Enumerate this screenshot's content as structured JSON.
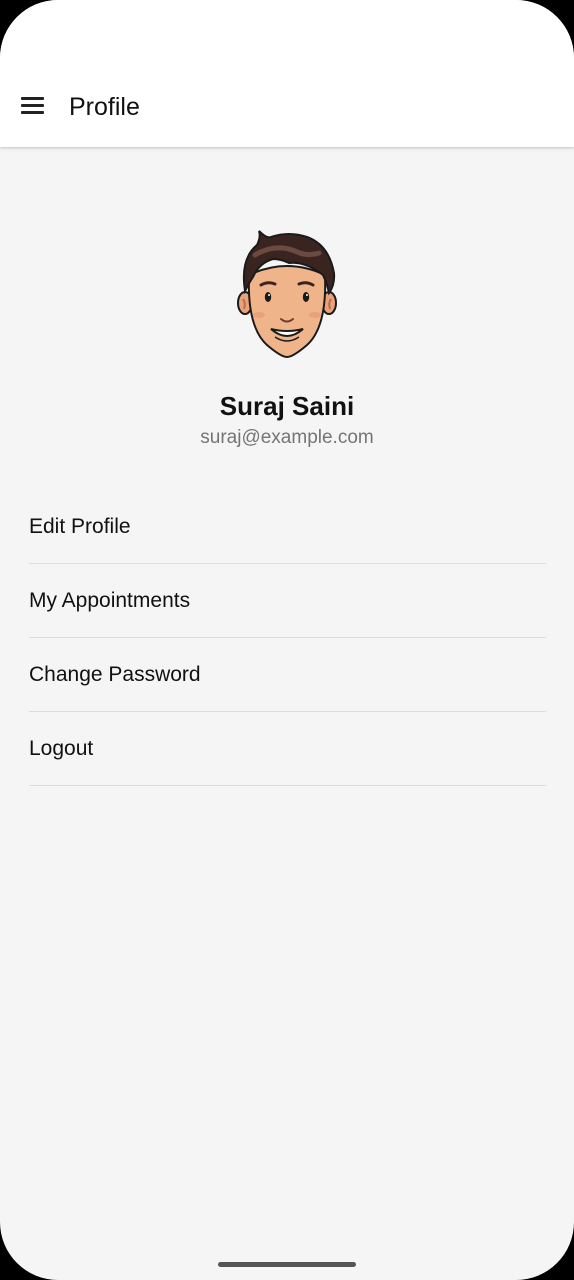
{
  "header": {
    "title": "Profile",
    "menu_icon": "hamburger-menu-icon"
  },
  "profile": {
    "avatar": "cartoon-boy-avatar",
    "name": "Suraj Saini",
    "email": "suraj@example.com"
  },
  "menu": {
    "items": [
      {
        "label": "Edit Profile"
      },
      {
        "label": "My Appointments"
      },
      {
        "label": "Change Password"
      },
      {
        "label": "Logout"
      }
    ]
  },
  "colors": {
    "background": "#f5f5f5",
    "app_bar": "#ffffff",
    "divider": "#dcdcdc",
    "email_text": "#757575"
  }
}
